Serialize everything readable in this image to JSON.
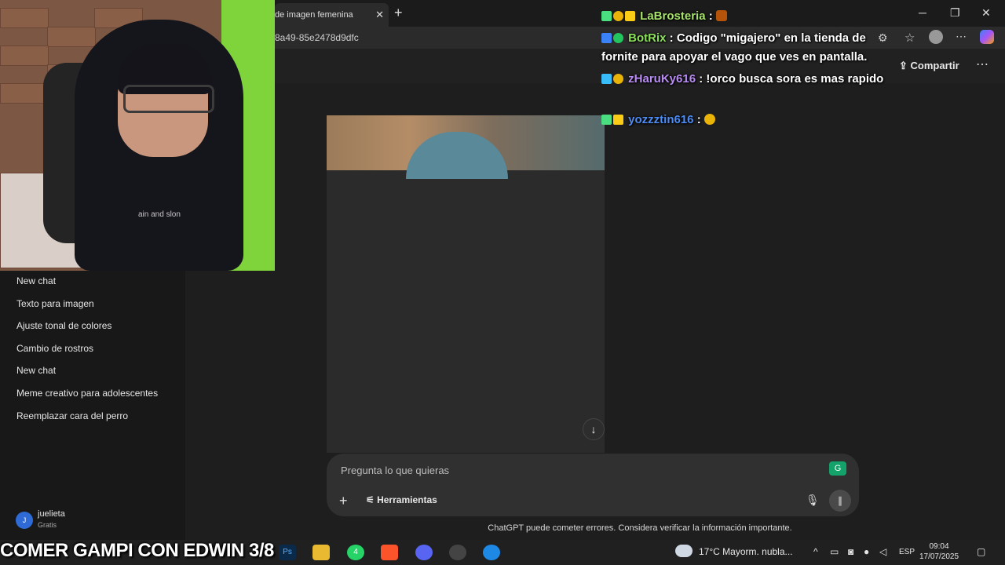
{
  "browser": {
    "tab_title": "de imagen femenina",
    "url_fragment": "8a49-85e2478d9dfc",
    "new_tab_glyph": "+",
    "close_glyph": "✕"
  },
  "page_header": {
    "share_label": "Compartir",
    "more_glyph": "⋯"
  },
  "sidebar": {
    "items": [
      {
        "label": "New chat"
      },
      {
        "label": "Texto para imagen"
      },
      {
        "label": "Ajuste tonal de colores"
      },
      {
        "label": "Cambio de rostros"
      },
      {
        "label": "New chat"
      },
      {
        "label": "Meme creativo para adolescentes"
      },
      {
        "label": "Reemplazar cara del perro"
      }
    ],
    "user": {
      "initial": "J",
      "name": "juelieta",
      "plan": "Gratis"
    }
  },
  "composer": {
    "placeholder": "Pregunta lo que quieras",
    "tools_label": "Herramientas"
  },
  "disclaimer": "ChatGPT puede cometer errores. Considera verificar la información importante.",
  "webcam": {
    "shirt_text": "ain and slon"
  },
  "chat_overlay": {
    "messages": [
      {
        "user": "LaBrosteria",
        "user_color": "#a6e36a",
        "text": ""
      },
      {
        "user": "BotRix",
        "user_color": "#8be05a",
        "text": "Codigo \"migajero\" en la tienda de fornite para apoyar el vago que ves en pantalla."
      },
      {
        "user": "zHaruKy616",
        "user_color": "#b98cf5",
        "text": "!orco busca sora es mas rapido"
      },
      {
        "user": "yozzztin616",
        "user_color": "#4d8cf5",
        "text": ""
      }
    ]
  },
  "stream_title": "COMER GAMPI CON EDWIN 3/8",
  "taskbar": {
    "weather": "17°C  Mayorm. nubla...",
    "lang": "ESP",
    "time": "09:04",
    "date": "17/07/2025",
    "whatsapp_badge": "4"
  }
}
